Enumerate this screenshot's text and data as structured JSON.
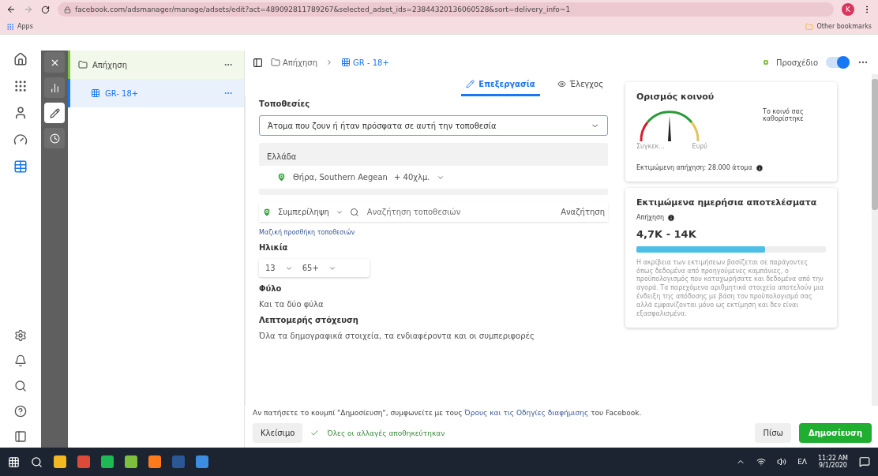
{
  "browser": {
    "url": "facebook.com/adsmanager/manage/adsets/edit?act=489092811789267&selected_adset_ids=23844320136060528&sort=delivery_info~1",
    "profile_initial": "K",
    "bookmarks": [
      "Apps"
    ],
    "other_bookmarks": "Other bookmarks"
  },
  "rail": [
    {
      "kind": "home",
      "selected": false
    },
    {
      "kind": "grid",
      "selected": false
    },
    {
      "kind": "avatar",
      "selected": false
    },
    {
      "kind": "gauge",
      "selected": false
    },
    {
      "kind": "table",
      "selected": true
    }
  ],
  "rail_bottom": [
    {
      "kind": "settings"
    },
    {
      "kind": "bell"
    },
    {
      "kind": "search"
    },
    {
      "kind": "help"
    },
    {
      "kind": "panel"
    }
  ],
  "tools": [
    {
      "kind": "close",
      "selected": false
    },
    {
      "kind": "chart",
      "selected": false
    },
    {
      "kind": "edit",
      "selected": true
    },
    {
      "kind": "clock",
      "selected": false
    }
  ],
  "tree": [
    {
      "label": "Απήχηση",
      "kind": "campaign",
      "selected": false,
      "children": [
        {
          "label": "GR- 18+",
          "kind": "adset",
          "selected": true
        }
      ]
    }
  ],
  "breadcrumb": [
    {
      "label": "Απήχηση",
      "kind": "campaign"
    },
    {
      "label": "GR - 18+",
      "kind": "adset"
    }
  ],
  "status": {
    "label": "Προσχέδιο",
    "on": true
  },
  "tabs": [
    {
      "label": "Επεξεργασία",
      "kind": "edit",
      "selected": true
    },
    {
      "label": "Έλεγχος",
      "kind": "review",
      "selected": false
    }
  ],
  "locations": {
    "title": "Τοποθεσίες",
    "mode": "Άτομα που ζουν ή ήταν πρόσφατα σε αυτή την τοποθεσία",
    "country": "Ελλάδα",
    "places": [
      {
        "name": "Θήρα, Southern Aegean",
        "radius": "+ 40χλμ."
      }
    ],
    "include": "Συμπερίληψη",
    "search_placeholder": "Αναζήτηση τοποθεσιών",
    "search_button": "Αναζήτηση",
    "bulk_link": "Μαζική προσθήκη τοποθεσιών"
  },
  "age": {
    "title": "Ηλικία",
    "min": "13",
    "max": "65+"
  },
  "gender": {
    "title": "Φύλο",
    "value": "Και τα δύο φύλα"
  },
  "detailed": {
    "title": "Λεπτομερής στόχευση",
    "value": "Όλα τα δημογραφικά στοιχεία, τα ενδιαφέροντα και οι συμπεριφορές"
  },
  "audience": {
    "title": "Ορισμός κοινού",
    "gauge_low": "Συγκεκ...",
    "gauge_high": "Ευρύ",
    "note": "Το κοινό σας καθορίστηκε",
    "estimate": "Εκτιμώμενη απήχηση: 28.000 άτομα"
  },
  "results": {
    "title": "Εκτιμώμενα ημερήσια αποτελέσματα",
    "metric": "Απήχηση",
    "range": "4,7K - 14K",
    "level": 0.68,
    "disclaimer": "Η ακρίβεια των εκτιμήσεων βασίζεται σε παράγοντες όπως δεδομένα από προηγούμενες καμπάνιες, ο προϋπολογισμός που καταχωρήσατε και δεδομένα από την αγορά. Τα παρεχόμενα αριθμητικά στοιχεία αποτελούν μια ένδειξη της απόδοσης με βάση τον προϋπολογισμό σας αλλά εμφανίζονται μόνο ως εκτίμηση και δεν είναι εξασφαλισμένα."
  },
  "footer": {
    "terms_before": "Αν πατήσετε το κουμπί \"Δημοσίευση\", συμφωνείτε με τους",
    "terms_link": "Όρους και τις Οδηγίες διαφήμισης",
    "terms_after": "του Facebook.",
    "close": "Κλείσιμο",
    "saved": "Όλες οι αλλαγές αποθηκεύτηκαν",
    "back": "Πίσω",
    "publish": "Δημοσίευση"
  },
  "taskbar": {
    "apps": [
      {
        "kind": "start"
      },
      {
        "kind": "search"
      },
      {
        "kind": "files",
        "color": "#f2b821"
      },
      {
        "kind": "browser",
        "color": "#de4a3a"
      },
      {
        "kind": "music",
        "color": "#1db954"
      },
      {
        "kind": "qgis",
        "color": "#7fbf3f"
      },
      {
        "kind": "firefox",
        "color": "#ff7a1a"
      },
      {
        "kind": "word",
        "color": "#2b5797"
      },
      {
        "kind": "photos",
        "color": "#3c8de0"
      }
    ],
    "language": "ΕΛ",
    "time": "11:22 AM",
    "date": "9/1/2020"
  }
}
